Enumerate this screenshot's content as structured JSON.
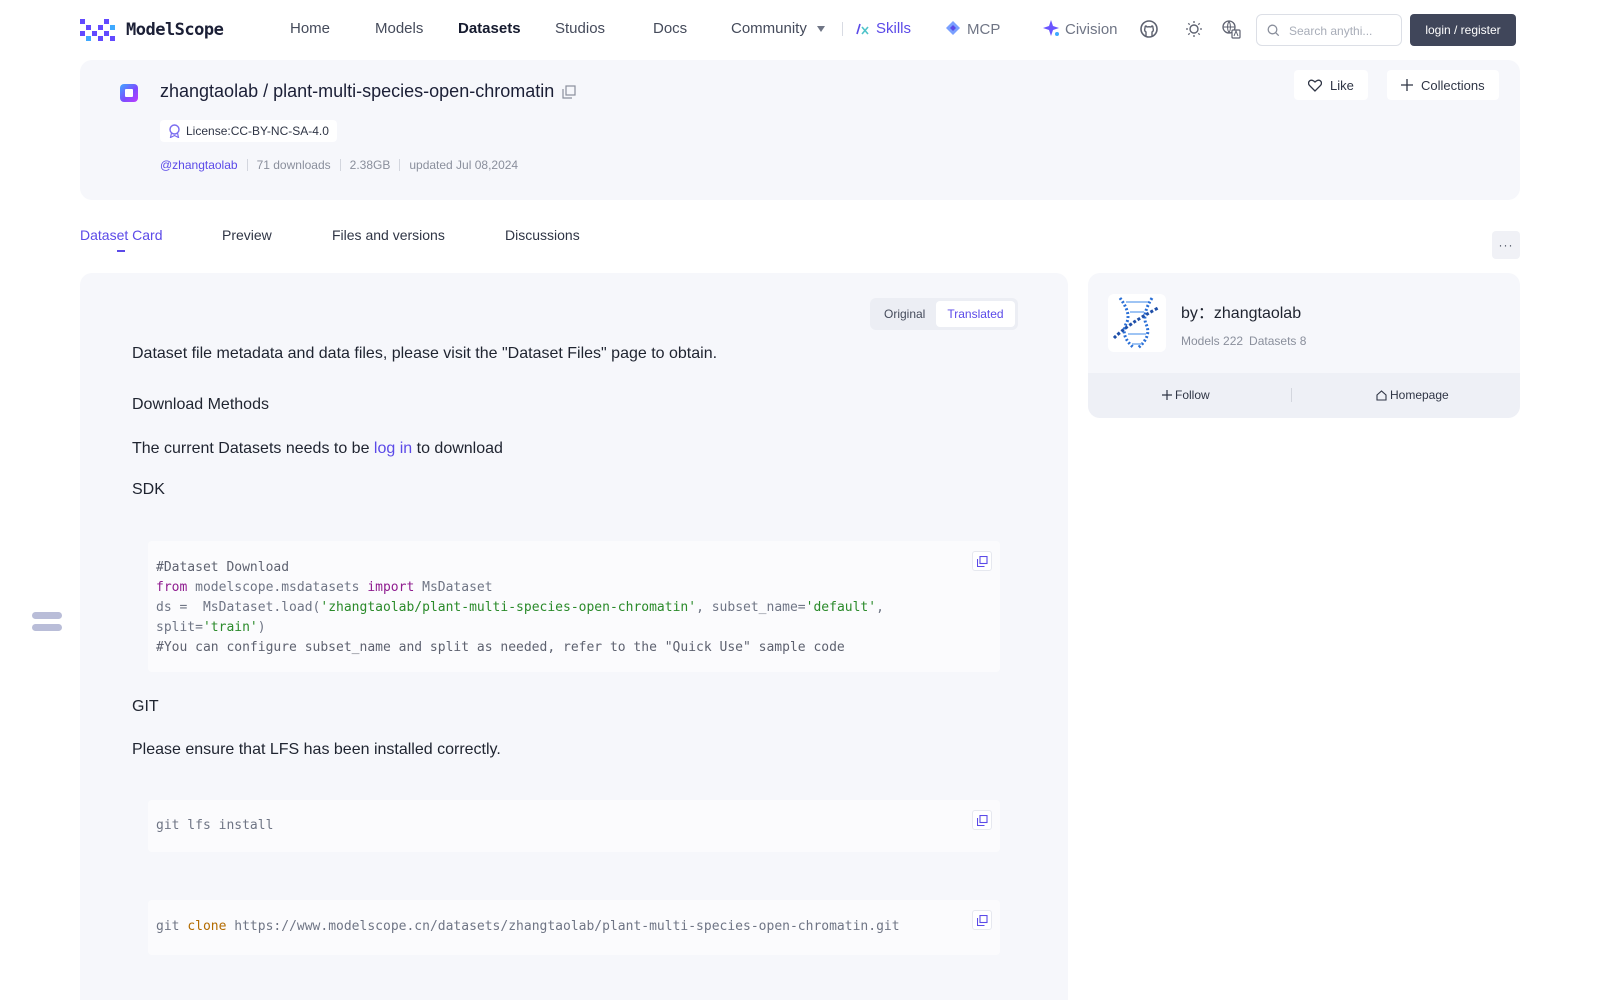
{
  "brand": {
    "name": "ModelScope",
    "accent": "#5b4ae8",
    "logo_color": "#624aff"
  },
  "nav": {
    "home": "Home",
    "models": "Models",
    "datasets": "Datasets",
    "studios": "Studios",
    "docs": "Docs",
    "community": "Community",
    "skills": "Skills",
    "mcp": "MCP",
    "civision": "Civision",
    "active": "Datasets"
  },
  "search": {
    "placeholder": "Search anythi..."
  },
  "auth": {
    "login_label": "login / register"
  },
  "dataset": {
    "owner": "zhangtaolab",
    "separator": "/",
    "name": "plant-multi-species-open-chromatin",
    "license": "License:CC-BY-NC-SA-4.0",
    "author_handle": "@zhangtaolab",
    "downloads": "71 downloads",
    "size": "2.38GB",
    "updated": "updated Jul 08,2024",
    "like_label": "Like",
    "collections_label": "Collections"
  },
  "tabs": [
    {
      "label": "Dataset Card",
      "active": true
    },
    {
      "label": "Preview",
      "active": false
    },
    {
      "label": "Files and versions",
      "active": false
    },
    {
      "label": "Discussions",
      "active": false
    }
  ],
  "more_label": "···",
  "content": {
    "toggle": {
      "original": "Original",
      "translated": "Translated",
      "selected": "Translated"
    },
    "intro": "Dataset file metadata and data files, please visit the \"Dataset Files\" page to obtain.",
    "download_heading": "Download Methods",
    "login_prefix": "The current Datasets needs to be",
    "login_link": "log in",
    "login_suffix": "to download",
    "sdk_heading": "SDK",
    "sdk_code": {
      "line1": "#Dataset Download",
      "line2_from": "from",
      "line2_module": " modelscope.msdatasets ",
      "line2_import": "import",
      "line2_class": " MsDataset",
      "line3_pre": "ds =  MsDataset.load(",
      "line3_repo": "'zhangtaolab/plant-multi-species-open-chromatin'",
      "line3_mid": ", subset_name=",
      "line3_subset": "'default'",
      "line3_end": ",",
      "line4_pre": "split=",
      "line4_split": "'train'",
      "line4_end": ")",
      "line5": "#You can configure subset_name and split as needed, refer to the \"Quick Use\" sample code"
    },
    "git_heading": "GIT",
    "lfs_note": "Please ensure that LFS has been installed correctly.",
    "git_lfs_cmd": "git lfs install",
    "git_clone_pre": "git ",
    "git_clone_kw": "clone",
    "git_clone_url": " https://www.modelscope.cn/datasets/zhangtaolab/plant-multi-species-open-chromatin.git"
  },
  "author_card": {
    "by_label": "by：zhangtaolab",
    "models": "Models 222",
    "datasets": "Datasets 8",
    "follow_label": "Follow",
    "homepage_label": "Homepage"
  }
}
